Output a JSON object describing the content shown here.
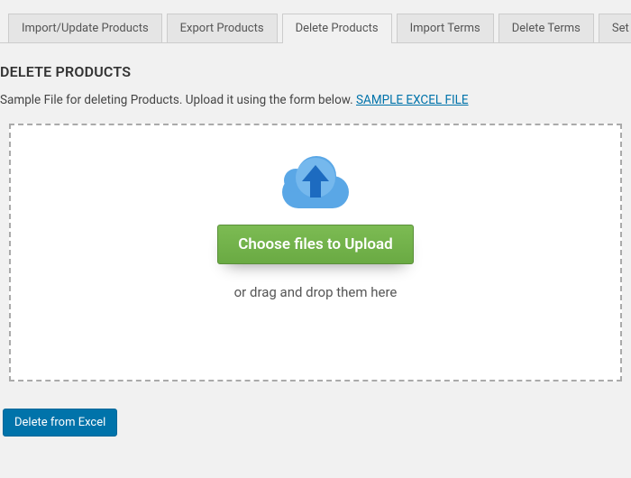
{
  "tabs": [
    {
      "label": "Import/Update Products",
      "active": false
    },
    {
      "label": "Export Products",
      "active": false
    },
    {
      "label": "Delete Products",
      "active": true
    },
    {
      "label": "Import Terms",
      "active": false
    },
    {
      "label": "Delete Terms",
      "active": false
    },
    {
      "label": "Set",
      "active": false
    }
  ],
  "page": {
    "heading": "DELETE PRODUCTS",
    "description_prefix": "Sample File for deleting Products. Upload it using the form below. ",
    "sample_link_text": "SAMPLE EXCEL FILE"
  },
  "upload": {
    "button_label": "Choose files to Upload",
    "drag_hint": "or drag and drop them here",
    "icon": "cloud-upload-icon"
  },
  "actions": {
    "delete_button_label": "Delete from Excel"
  },
  "colors": {
    "accent_blue": "#0073aa",
    "upload_green": "#6aaa43",
    "cloud": "#5aa7e6",
    "arrow": "#1d6bc0"
  }
}
